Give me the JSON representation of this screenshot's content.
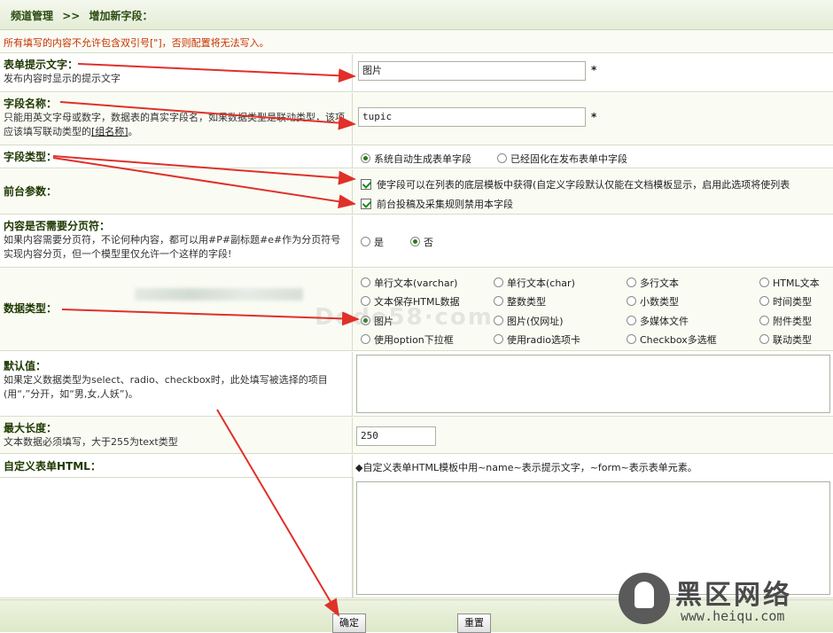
{
  "breadcrumb": {
    "parent": "频道管理",
    "sep": ">>",
    "current": "增加新字段："
  },
  "notice": "所有填写的内容不允许包含双引号[\"]，否则配置将无法写入。",
  "fields": {
    "itemname": {
      "label": "表单提示文字：",
      "desc": "发布内容时显示的提示文字",
      "value": "图片",
      "required": "*"
    },
    "fieldname": {
      "label": "字段名称：",
      "desc": "只能用英文字母或数字，数据表的真实字段名，如果数据类型是联动类型，该项应该填写联动类型的",
      "link": "[组名称]",
      "desc_end": "。",
      "value": "tupic",
      "required": "*"
    },
    "fieldtype": {
      "label": "字段类型：",
      "options": [
        "系统自动生成表单字段",
        "已经固化在发布表单中字段"
      ],
      "selected": 0
    },
    "frontend": {
      "label": "前台参数：",
      "checks": [
        {
          "text": "使字段可以在列表的底层模板中获得(自定义字段默认仅能在文档模板显示，启用此选项将使列表",
          "checked": true
        },
        {
          "text": "前台投稿及采集规则禁用本字段",
          "checked": true
        }
      ]
    },
    "pagebreak": {
      "label": "内容是否需要分页符：",
      "desc": "如果内容需要分页符，不论何种内容，都可以用#P#副标题#e#作为分页符号实现内容分页，但一个模型里仅允许一个这样的字段!",
      "options": [
        "是",
        "否"
      ],
      "selected": 1
    },
    "datatype": {
      "label": "数据类型：",
      "options": [
        "单行文本(varchar)",
        "单行文本(char)",
        "多行文本",
        "HTML文本",
        "文本保存HTML数据",
        "整数类型",
        "小数类型",
        "时间类型",
        "图片",
        "图片(仅网址)",
        "多媒体文件",
        "附件类型",
        "使用option下拉框",
        "使用radio选项卡",
        "Checkbox多选框",
        "联动类型"
      ],
      "selected": 8
    },
    "default": {
      "label": "默认值：",
      "desc": "如果定义数据类型为select、radio、checkbox时，此处填写被选择的项目(用“,”分开，如“男,女,人妖”)。"
    },
    "maxlength": {
      "label": "最大长度：",
      "desc": "文本数据必须填写，大于255为text类型",
      "value": "250"
    },
    "customhtml": {
      "label": "自定义表单HTML：",
      "hint": "◆自定义表单HTML模板中用~name~表示提示文字，~form~表示表单元素。"
    }
  },
  "buttons": {
    "ok": "确定",
    "reset": "重置"
  },
  "watermark": {
    "title": "黑区网络",
    "url": "www.heiqu.com"
  },
  "faint_watermark": "Dede58·com",
  "colors": {
    "label": "#1e3800",
    "notice": "#c43300",
    "arrow": "#e0302a",
    "header_bg": "#e4ecd6"
  }
}
